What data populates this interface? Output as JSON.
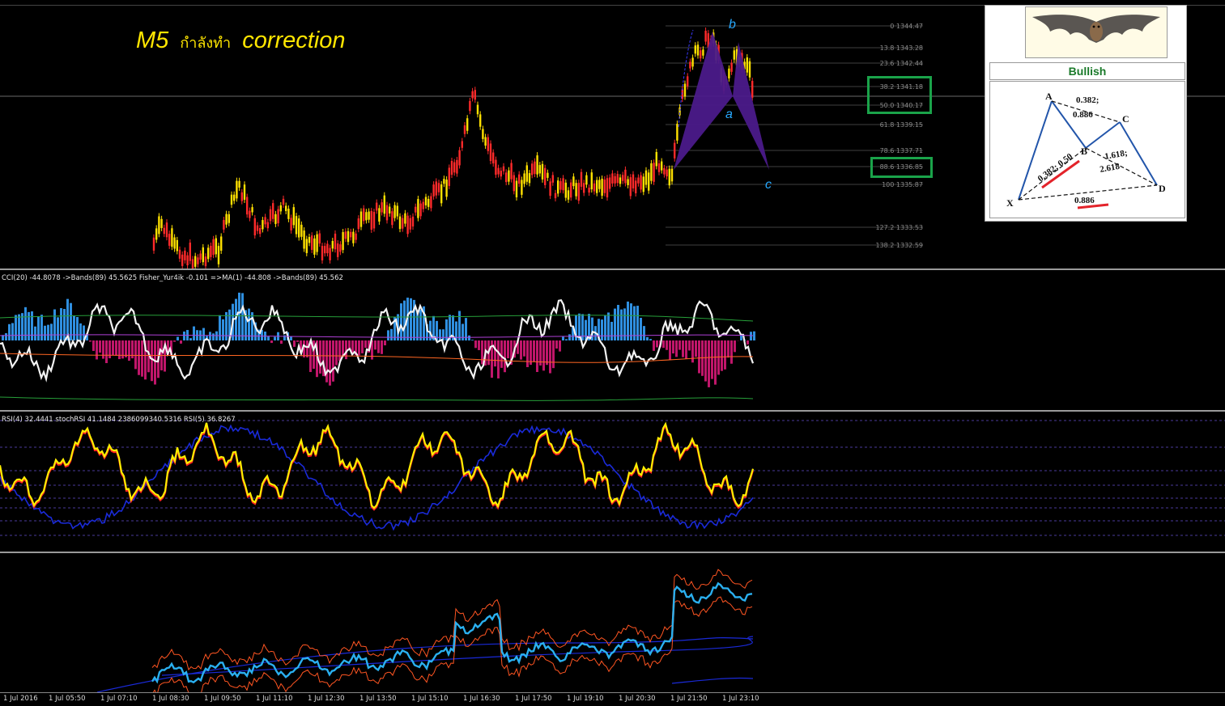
{
  "chart": {
    "title_left": "M5",
    "title_thai": "กำลังทำ",
    "title_right": "correction",
    "wave_labels": {
      "b": "b",
      "a": "a",
      "c": "c"
    },
    "fib_levels": [
      {
        "label": "0 1344.47"
      },
      {
        "label": "13.8 1343.28"
      },
      {
        "label": "23.6 1342.44"
      },
      {
        "label": "38.2 1341.18"
      },
      {
        "label": "50.0 1340.17"
      },
      {
        "label": "61.8 1339.15"
      },
      {
        "label": "78.6 1337.71"
      },
      {
        "label": "88.6 1336.85"
      },
      {
        "label": "100 1335.87"
      },
      {
        "label": "127.2 1333.53"
      },
      {
        "label": "138.2 1332.59"
      }
    ],
    "colors": {
      "bull_candle": "#ffe100",
      "bear_candle": "#ff2a2a",
      "pattern_fill": "#4b1a8a",
      "wave_label": "#27a9ff",
      "highlight_box": "#1aa34a"
    }
  },
  "bat_panel": {
    "heading": "Bullish",
    "points": {
      "X": "X",
      "A": "A",
      "B": "B",
      "C": "C",
      "D": "D"
    },
    "ratios": {
      "ab1": "0.382;",
      "ab2": "0.886",
      "xb": "0.382; 0.50",
      "bd1": "1.618;",
      "bd2": "2.618",
      "xd": "0.886"
    }
  },
  "indicators": {
    "cci_label": "CCI(20) -44.8078  ->Bands(89) 45.5625  Fisher_Yur4ik -0.101  =>MA(1) -44.808  ->Bands(89) 45.562",
    "rsi_label": "RSI(4) 32.4441  stochRSI 41.1484 2386099340.5316  RSI(5) 36.8267"
  },
  "xaxis": {
    "ticks": [
      "1 Jul 2016",
      "1 Jul 05:50",
      "1 Jul 07:10",
      "1 Jul 08:30",
      "1 Jul 09:50",
      "1 Jul 11:10",
      "1 Jul 12:30",
      "1 Jul 13:50",
      "1 Jul 15:10",
      "1 Jul 16:30",
      "1 Jul 17:50",
      "1 Jul 19:10",
      "1 Jul 20:30",
      "1 Jul 21:50",
      "1 Jul 23:10"
    ]
  }
}
